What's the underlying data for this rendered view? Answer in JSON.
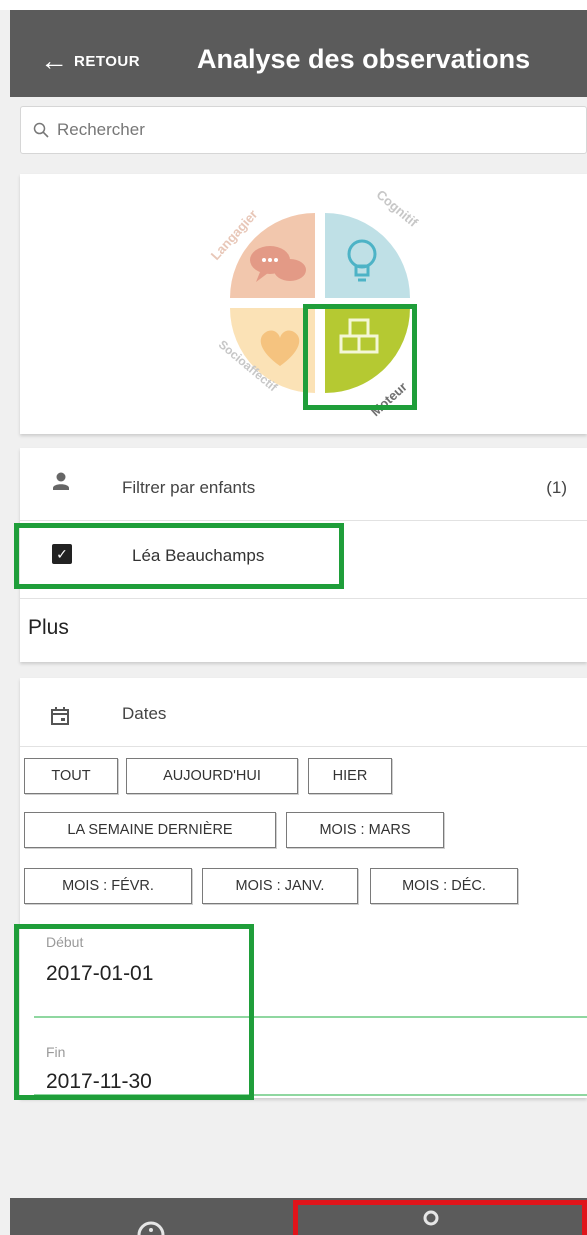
{
  "header": {
    "back_label": "RETOUR",
    "title": "Analyse des observations"
  },
  "search": {
    "placeholder": "Rechercher"
  },
  "domains_wheel": {
    "segments": [
      {
        "label": "Langagier",
        "color": "#f2c7ad",
        "icon": "speech-bubbles-icon"
      },
      {
        "label": "Cognitif",
        "color": "#bfe0e6",
        "icon": "lightbulb-icon"
      },
      {
        "label": "Socioaffectif",
        "color": "#fbe2b6",
        "icon": "heart-icon"
      },
      {
        "label": "Moteur",
        "color": "#b5c932",
        "icon": "blocks-icon",
        "selected": true
      }
    ]
  },
  "filter_children": {
    "label": "Filtrer par enfants",
    "count": "(1)",
    "children": [
      {
        "name": "Léa Beauchamps",
        "checked": true
      }
    ],
    "more_label": "Plus"
  },
  "dates": {
    "label": "Dates",
    "chips": [
      "TOUT",
      "AUJOURD'HUI",
      "HIER",
      "LA SEMAINE DERNIÈRE",
      "MOIS : MARS",
      "MOIS : FÉVR.",
      "MOIS : JANV.",
      "MOIS : DÉC."
    ],
    "start": {
      "label": "Début",
      "value": "2017-01-01"
    },
    "end": {
      "label": "Fin",
      "value": "2017-11-30"
    }
  },
  "bottom_nav": {
    "items": [
      {
        "icon": "info-icon"
      },
      {
        "icon": "person-icon",
        "highlighted": true
      }
    ]
  }
}
